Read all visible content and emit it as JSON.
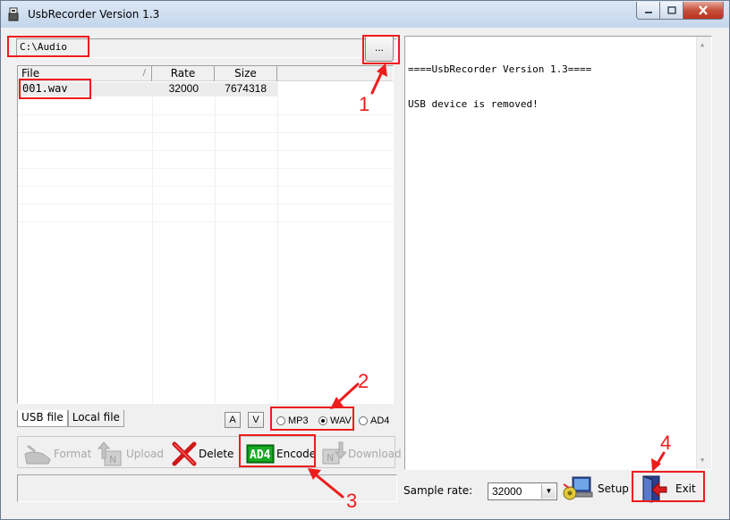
{
  "window": {
    "title": "UsbRecorder Version 1.3"
  },
  "path": {
    "value": "C:\\Audio",
    "browse_label": "..."
  },
  "file_list": {
    "columns": [
      "File",
      "Rate",
      "Size"
    ],
    "sort_indicator": "/",
    "rows": [
      {
        "file": "001.wav",
        "rate": "32000",
        "size": "7674318"
      }
    ]
  },
  "tabs": [
    "USB file",
    "Local file"
  ],
  "sort_buttons": [
    "A",
    "V"
  ],
  "formats": {
    "options": [
      "MP3",
      "WAV",
      "AD4"
    ],
    "selected": "WAV"
  },
  "toolbar": {
    "format": "Format",
    "upload": "Upload",
    "delete": "Delete",
    "encode": "Encode",
    "encode_icon_text": "AD4",
    "download": "Download"
  },
  "log": {
    "lines": [
      "====UsbRecorder Version 1.3====",
      "USB device is removed!"
    ]
  },
  "sample_rate": {
    "label": "Sample rate:",
    "value": "32000"
  },
  "setup_label": "Setup",
  "exit_label": "Exit",
  "annotations": {
    "n1": "1",
    "n2": "2",
    "n3": "3",
    "n4": "4"
  },
  "colors": {
    "annotation": "#ee1c1c",
    "encode_icon_bg": "#0a8a12"
  }
}
